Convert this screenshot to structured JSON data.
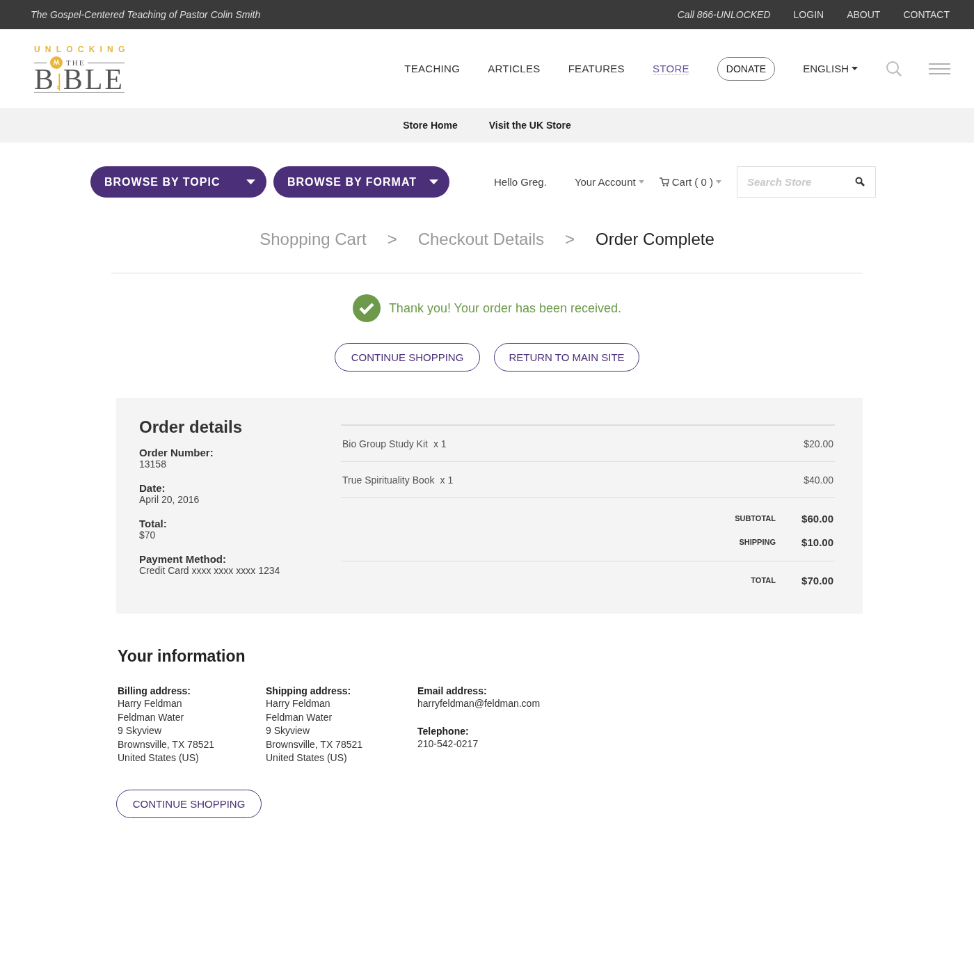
{
  "top_bar": {
    "tagline": "The Gospel-Centered Teaching of Pastor Colin Smith",
    "phone": "Call 866-UNLOCKED",
    "links": [
      "LOGIN",
      "ABOUT",
      "CONTACT"
    ]
  },
  "logo": {
    "top": "UNLOCKING",
    "middle": "THE",
    "left": "B",
    "right": "BLE"
  },
  "nav": {
    "items": [
      {
        "label": "TEACHING",
        "selected": false
      },
      {
        "label": "ARTICLES",
        "selected": false
      },
      {
        "label": "FEATURES",
        "selected": false
      },
      {
        "label": "STORE",
        "selected": true
      }
    ],
    "donate": "DONATE",
    "language": "ENGLISH"
  },
  "store_nav": [
    "Store Home",
    "Visit the UK Store"
  ],
  "store_bar": {
    "browse": [
      "BROWSE BY TOPIC",
      "BROWSE BY FORMAT"
    ],
    "greeting": "Hello Greg.",
    "account": "Your Account",
    "cart": "Cart ( 0 )",
    "search": {
      "placeholder": "Search Store"
    }
  },
  "steps": [
    {
      "label": "Shopping Cart",
      "selected": false
    },
    {
      "label": "Checkout Details",
      "selected": false
    },
    {
      "label": "Order Complete",
      "selected": true
    }
  ],
  "step_separator": ">",
  "confirmation": "Thank you! Your order has been received.",
  "actions": [
    "CONTINUE SHOPPING",
    "RETURN TO MAIN SITE"
  ],
  "order_details": {
    "title": "Order details",
    "fields": [
      {
        "label": "Order Number:",
        "value": "13158"
      },
      {
        "label": "Date:",
        "value": "April 20, 2016"
      },
      {
        "label": "Total:",
        "value": "$70"
      },
      {
        "label": "Payment Method:",
        "value": "Credit Card xxxx xxxx xxxx 1234"
      }
    ],
    "items": [
      {
        "name": "Bio Group Study Kit",
        "qty": "x 1",
        "price": "$20.00"
      },
      {
        "name": "True Spirituality Book",
        "qty": "x 1",
        "price": "$40.00"
      }
    ],
    "subtotals": [
      {
        "label": "SUBTOTAL",
        "value": "$60.00"
      },
      {
        "label": "SHIPPING",
        "value": "$10.00"
      }
    ],
    "total": {
      "label": "TOTAL",
      "value": "$70.00"
    }
  },
  "your_information": {
    "title": "Your information",
    "columns": [
      {
        "blocks": [
          {
            "label": "Billing address:",
            "lines": [
              "Harry Feldman",
              "Feldman Water",
              "9 Skyview",
              "Brownsville, TX 78521",
              "United States (US)"
            ]
          }
        ]
      },
      {
        "blocks": [
          {
            "label": "Shipping address:",
            "lines": [
              "Harry Feldman",
              "Feldman Water",
              "9 Skyview",
              "Brownsville, TX 78521",
              "United States (US)"
            ]
          }
        ]
      },
      {
        "blocks": [
          {
            "label": "Email address:",
            "lines": [
              "harryfeldman@feldman.com"
            ]
          },
          {
            "label": "Telephone:",
            "lines": [
              "210-542-0217"
            ]
          }
        ]
      }
    ]
  },
  "bottom_action": "CONTINUE SHOPPING"
}
